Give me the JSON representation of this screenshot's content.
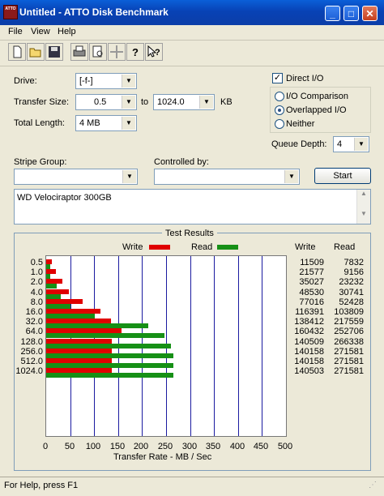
{
  "window": {
    "title": "Untitled - ATTO Disk Benchmark",
    "icon_text": "ATTO"
  },
  "menu": [
    "File",
    "View",
    "Help"
  ],
  "toolbar": [
    "new-icon",
    "open-icon",
    "save-icon",
    "print-icon",
    "print-preview-icon",
    "move-icon",
    "help-icon",
    "context-help-icon"
  ],
  "form": {
    "drive_label": "Drive:",
    "drive_value": "[-f-]",
    "transfer_label": "Transfer Size:",
    "transfer_from": "0.5",
    "to_label": "to",
    "transfer_to": "1024.0",
    "kb_label": "KB",
    "total_label": "Total Length:",
    "total_value": "4 MB",
    "direct_io": "Direct I/O",
    "io_comparison": "I/O Comparison",
    "overlapped_io": "Overlapped I/O",
    "neither": "Neither",
    "queue_label": "Queue Depth:",
    "queue_value": "4",
    "stripe_label": "Stripe Group:",
    "controlled_label": "Controlled by:",
    "start": "Start",
    "description": "WD Velociraptor 300GB"
  },
  "results": {
    "title": "Test Results",
    "legend_write": "Write",
    "legend_read": "Read",
    "col_write": "Write",
    "col_read": "Read",
    "xlabel": "Transfer Rate - MB / Sec",
    "write_color": "#e00000",
    "read_color": "#169016"
  },
  "chart_data": {
    "type": "bar",
    "categories": [
      "0.5",
      "1.0",
      "2.0",
      "4.0",
      "8.0",
      "16.0",
      "32.0",
      "64.0",
      "128.0",
      "256.0",
      "512.0",
      "1024.0"
    ],
    "series": [
      {
        "name": "Write",
        "values": [
          11509,
          21577,
          35027,
          48530,
          77016,
          116391,
          138412,
          160432,
          140509,
          140158,
          140158,
          140503
        ]
      },
      {
        "name": "Read",
        "values": [
          7832,
          9156,
          23232,
          30741,
          52428,
          103809,
          217559,
          252706,
          266338,
          271581,
          271581,
          271581
        ]
      }
    ],
    "xlabel": "Transfer Rate - MB / Sec",
    "xlim": [
      0,
      500
    ],
    "xticks": [
      "0",
      "50",
      "100",
      "150",
      "200",
      "250",
      "300",
      "350",
      "400",
      "450",
      "500"
    ],
    "grid": true,
    "orientation": "horizontal"
  },
  "status": "For Help, press F1"
}
